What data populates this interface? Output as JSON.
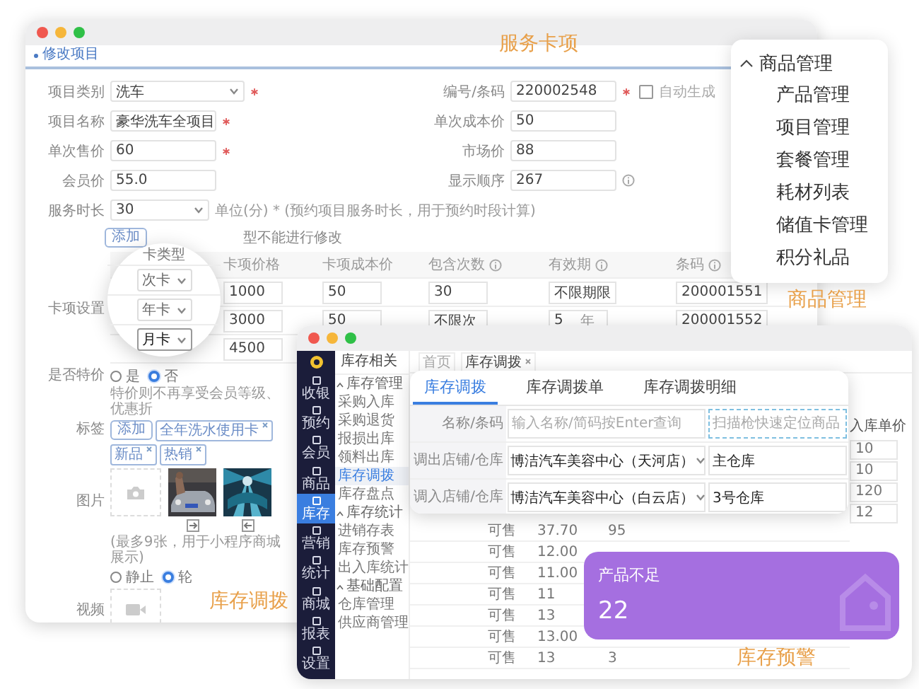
{
  "captions": [
    {
      "text": "服务卡项"
    },
    {
      "text": "商品管理"
    },
    {
      "text": "库存调拨"
    },
    {
      "text": "库存预警"
    }
  ],
  "form_window": {
    "header": "修改项目",
    "left_fields": [
      {
        "label": "项目类别",
        "kind": "select",
        "value": "洗车",
        "required": true
      },
      {
        "label": "项目名称",
        "kind": "text",
        "value": "豪华洗车全项目",
        "required": true
      },
      {
        "label": "单次售价",
        "kind": "text",
        "value": "60",
        "required": true
      },
      {
        "label": "会员价",
        "kind": "text",
        "value": "55.0",
        "required": false
      },
      {
        "label": "服务时长",
        "kind": "select",
        "value": "30",
        "required": false,
        "note": "单位(分) * (预约项目服务时长，用于预约时段计算)"
      }
    ],
    "right_fields": [
      {
        "label": "编号/条码",
        "kind": "checkbox",
        "value": "220002548",
        "required": true,
        "option": "自动生成",
        "checked": false
      },
      {
        "label": "单次成本价",
        "kind": "text",
        "value": "50",
        "required": false
      },
      {
        "label": "市场价",
        "kind": "text",
        "value": "88",
        "required": false
      },
      {
        "label": "显示顺序",
        "kind": "info",
        "value": "267",
        "required": false
      }
    ],
    "add_button": "添加",
    "card_hint": "型不能进行修改",
    "card_settings": {
      "label": "卡项设置",
      "columns": [
        {
          "title": "卡项价格",
          "info": false
        },
        {
          "title": "卡项成本价",
          "info": false
        },
        {
          "title": "包含次数",
          "info": true
        },
        {
          "title": "有效期",
          "info": true
        },
        {
          "title": "条码",
          "info": true
        }
      ],
      "rows": [
        {
          "cells": [
            {
              "value": "1000"
            },
            {
              "value": "50"
            },
            {
              "value": "30"
            },
            {
              "value": "不限期限"
            },
            {
              "value": "200001551"
            }
          ]
        },
        {
          "cells": [
            {
              "value": "3000"
            },
            {
              "value": "50"
            },
            {
              "value": "不限次"
            },
            {
              "value": "5",
              "unit": "年"
            },
            {
              "value": "200001552"
            }
          ]
        },
        {
          "cells": [
            {
              "value": "4500"
            }
          ]
        }
      ]
    },
    "magnifier": {
      "title": "卡类型",
      "options": [
        {
          "value": "次卡",
          "highlighted": false
        },
        {
          "value": "年卡",
          "highlighted": false
        },
        {
          "value": "月卡",
          "highlighted": true
        }
      ]
    },
    "special": {
      "label": "是否特价",
      "options": [
        {
          "label": "是",
          "selected": false
        },
        {
          "label": "否",
          "selected": true
        }
      ],
      "hint": "特价则不再享受会员等级、优惠折"
    },
    "tags": {
      "label": "标签",
      "add": "添加",
      "items": [
        {
          "text": "全年洗水使用卡"
        },
        {
          "text": "新品"
        },
        {
          "text": "热销"
        }
      ]
    },
    "images": {
      "label": "图片",
      "hint": "(最多9张，用于小程序商城展示)",
      "modes": [
        {
          "label": "静止",
          "selected": false
        },
        {
          "label": "轮",
          "selected": true
        }
      ]
    },
    "video": {
      "label": "视频"
    }
  },
  "menu_card": {
    "title": "商品管理",
    "expanded": true,
    "items": [
      {
        "label": "产品管理"
      },
      {
        "label": "项目管理"
      },
      {
        "label": "套餐管理"
      },
      {
        "label": "耗材列表"
      },
      {
        "label": "储值卡管理"
      },
      {
        "label": "积分礼品"
      }
    ]
  },
  "inventory_window": {
    "sidebar": [
      {
        "label": "收银",
        "selected": false
      },
      {
        "label": "预约",
        "selected": false
      },
      {
        "label": "会员",
        "selected": false
      },
      {
        "label": "商品",
        "selected": false
      },
      {
        "label": "库存",
        "selected": true
      },
      {
        "label": "营销",
        "selected": false
      },
      {
        "label": "统计",
        "selected": false
      },
      {
        "label": "商城",
        "selected": false
      },
      {
        "label": "报表",
        "selected": false
      },
      {
        "label": "设置",
        "selected": false
      }
    ],
    "subnav": {
      "title": "库存相关",
      "groups": [
        {
          "title": "库存管理",
          "expanded": true,
          "items": [
            {
              "label": "采购入库",
              "selected": false
            },
            {
              "label": "采购退货",
              "selected": false
            },
            {
              "label": "报损出库",
              "selected": false
            },
            {
              "label": "领料出库",
              "selected": false
            },
            {
              "label": "库存调拨",
              "selected": true
            },
            {
              "label": "库存盘点",
              "selected": false
            }
          ]
        },
        {
          "title": "库存统计",
          "expanded": true,
          "items": [
            {
              "label": "进销存表",
              "selected": false
            },
            {
              "label": "库存预警",
              "selected": false
            },
            {
              "label": "出入库统计",
              "selected": false
            }
          ]
        },
        {
          "title": "基础配置",
          "expanded": true,
          "items": [
            {
              "label": "仓库管理",
              "selected": false
            },
            {
              "label": "供应商管理",
              "selected": false
            }
          ]
        }
      ]
    },
    "breadcrumbs": [
      {
        "label": "首页",
        "selected": false,
        "closable": false
      },
      {
        "label": "库存调拨",
        "selected": true,
        "closable": true
      }
    ],
    "rows": [
      {
        "status": "可售",
        "price": "37.70",
        "qty": "95"
      },
      {
        "status": "可售",
        "price": "12.00"
      },
      {
        "status": "可售",
        "price": "11.00"
      },
      {
        "status": "可售",
        "price": "11"
      },
      {
        "status": "可售",
        "price": "13"
      },
      {
        "status": "可售",
        "price": "13.00"
      },
      {
        "status": "可售",
        "price": "13",
        "qty": "3"
      }
    ],
    "side_column": {
      "title": "入库单价",
      "values": [
        "10",
        "10",
        "120",
        "12"
      ]
    }
  },
  "transfer_card": {
    "tabs": [
      {
        "label": "库存调拨",
        "selected": true
      },
      {
        "label": "库存调拨单",
        "selected": false
      },
      {
        "label": "库存调拨明细",
        "selected": false
      }
    ],
    "rows": [
      {
        "kind": "search",
        "label": "名称/条码",
        "placeholder": "输入名称/简码按Enter查询",
        "scan_placeholder": "扫描枪快速定位商品"
      },
      {
        "kind": "select",
        "label": "调出店铺/仓库",
        "store": "博洁汽车美容中心（天河店）",
        "warehouse": "主仓库"
      },
      {
        "kind": "select",
        "label": "调入店铺/仓库",
        "store": "博洁汽车美容中心（白云店）",
        "warehouse": "3号仓库"
      }
    ]
  },
  "alert_card": {
    "title": "产品不足",
    "count": "22"
  }
}
